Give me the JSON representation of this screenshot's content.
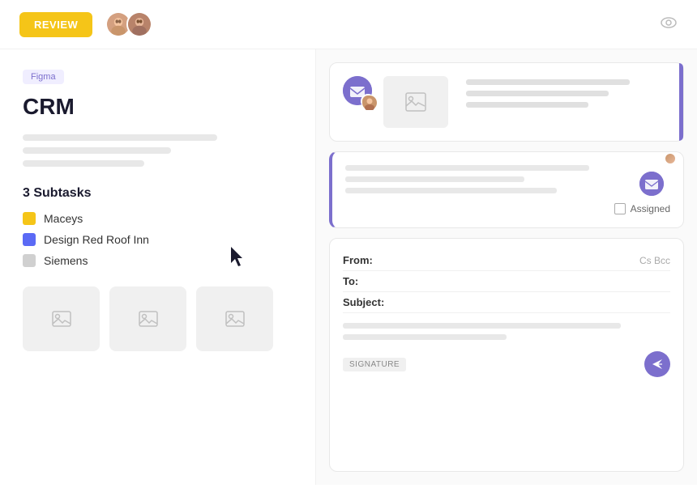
{
  "topbar": {
    "review_label": "REVIEW",
    "eye_icon": "👁"
  },
  "left": {
    "badge": "Figma",
    "title": "CRM",
    "subtasks_title": "3 Subtasks",
    "subtasks": [
      {
        "label": "Maceys",
        "color": "yellow"
      },
      {
        "label": "Design Red Roof Inn",
        "color": "blue"
      },
      {
        "label": "Siemens",
        "color": "gray"
      }
    ]
  },
  "right": {
    "card1": {
      "preview_icon": "🖼"
    },
    "card2": {
      "assigned_label": "Assigned"
    },
    "compose": {
      "from_label": "From:",
      "to_label": "To:",
      "subject_label": "Subject:",
      "cc_label": "Cs Bcc",
      "signature_label": "SIGNATURE"
    }
  }
}
